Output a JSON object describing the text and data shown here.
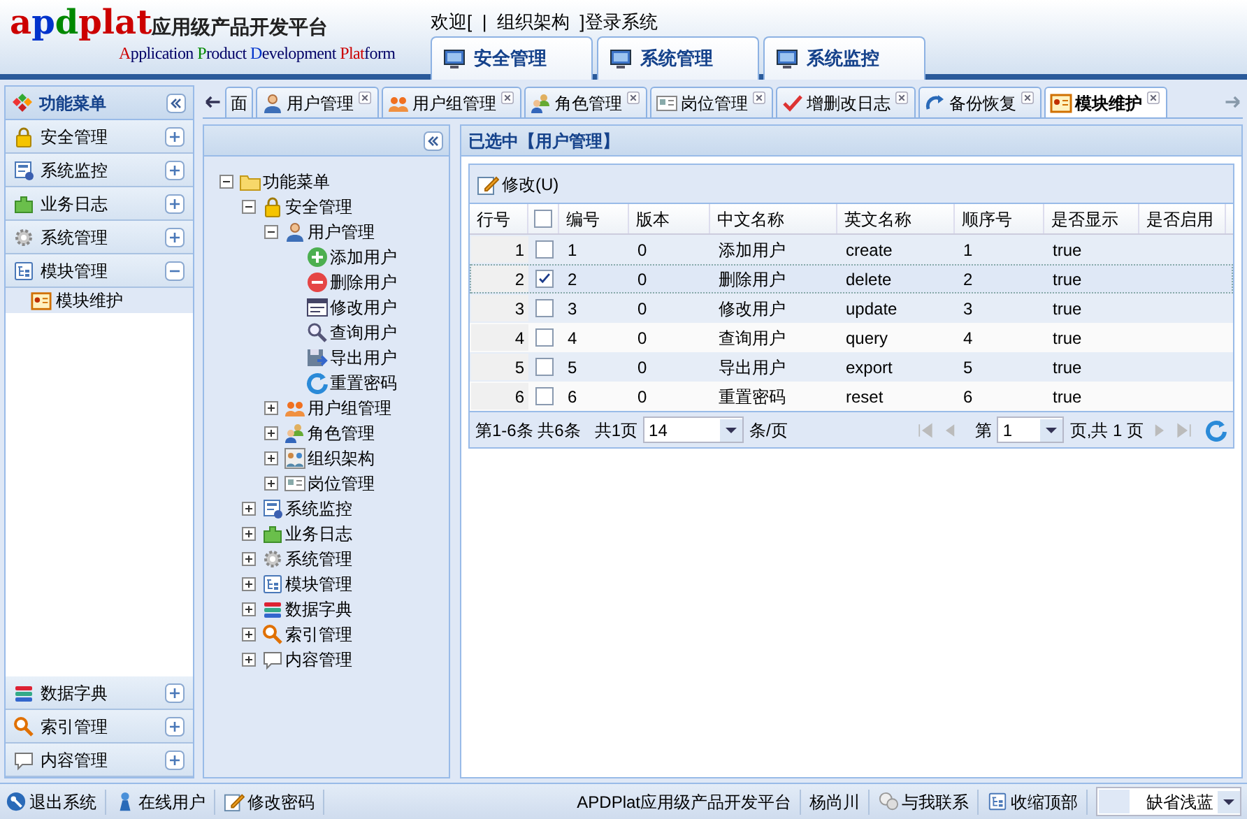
{
  "logo": {
    "brand": [
      {
        "text": "a",
        "color": "#cc0000"
      },
      {
        "text": "p",
        "color": "#0033cc"
      },
      {
        "text": "d",
        "color": "#008800"
      },
      {
        "text": "plat",
        "color": "#cc0000"
      }
    ],
    "subtitle": "应用级产品开发平台",
    "tagline": [
      {
        "text": "A",
        "color": "#cc0000"
      },
      {
        "text": "pplication ",
        "color": "#000066"
      },
      {
        "text": "P",
        "color": "#008800"
      },
      {
        "text": "roduct ",
        "color": "#000066"
      },
      {
        "text": "D",
        "color": "#0033cc"
      },
      {
        "text": "evelopment ",
        "color": "#000066"
      },
      {
        "text": "Plat",
        "color": "#cc0000"
      },
      {
        "text": "form",
        "color": "#000066"
      }
    ]
  },
  "welcome": "欢迎[  |  组织架构  ]登录系统",
  "top_tabs": [
    {
      "label": "安全管理"
    },
    {
      "label": "系统管理"
    },
    {
      "label": "系统监控"
    }
  ],
  "sidebar": {
    "title": "功能菜单",
    "groups": [
      {
        "label": "安全管理",
        "expanded": false
      },
      {
        "label": "系统监控",
        "expanded": false
      },
      {
        "label": "业务日志",
        "expanded": false
      },
      {
        "label": "系统管理",
        "expanded": false
      },
      {
        "label": "模块管理",
        "expanded": true,
        "children": [
          {
            "label": "模块维护",
            "selected": true
          }
        ]
      },
      {
        "label": "数据字典",
        "expanded": false
      },
      {
        "label": "索引管理",
        "expanded": false
      },
      {
        "label": "内容管理",
        "expanded": false
      }
    ]
  },
  "tabs": [
    {
      "label": "面",
      "selected": false,
      "closable": false
    },
    {
      "label": "用户管理",
      "selected": false,
      "closable": true
    },
    {
      "label": "用户组管理",
      "selected": false,
      "closable": true
    },
    {
      "label": "角色管理",
      "selected": false,
      "closable": true
    },
    {
      "label": "岗位管理",
      "selected": false,
      "closable": true
    },
    {
      "label": "增删改日志",
      "selected": false,
      "closable": true
    },
    {
      "label": "备份恢复",
      "selected": false,
      "closable": true
    },
    {
      "label": "模块维护",
      "selected": true,
      "closable": true
    }
  ],
  "tree": [
    {
      "label": "功能菜单",
      "expanded": true,
      "children": [
        {
          "label": "安全管理",
          "expanded": true,
          "children": [
            {
              "label": "用户管理",
              "expanded": true,
              "children": [
                {
                  "label": "添加用户"
                },
                {
                  "label": "删除用户"
                },
                {
                  "label": "修改用户"
                },
                {
                  "label": "查询用户"
                },
                {
                  "label": "导出用户"
                },
                {
                  "label": "重置密码"
                }
              ]
            },
            {
              "label": "用户组管理",
              "expanded": false
            },
            {
              "label": "角色管理",
              "expanded": false
            },
            {
              "label": "组织架构",
              "expanded": false
            },
            {
              "label": "岗位管理",
              "expanded": false
            }
          ]
        },
        {
          "label": "系统监控",
          "expanded": false
        },
        {
          "label": "业务日志",
          "expanded": false
        },
        {
          "label": "系统管理",
          "expanded": false
        },
        {
          "label": "模块管理",
          "expanded": false
        },
        {
          "label": "数据字典",
          "expanded": false
        },
        {
          "label": "索引管理",
          "expanded": false
        },
        {
          "label": "内容管理",
          "expanded": false
        }
      ]
    }
  ],
  "panel": {
    "title": "已选中【用户管理】",
    "toolbar": [
      "修改(U)"
    ],
    "table": {
      "all_checked": false,
      "columns": [
        "行号",
        "",
        "编号",
        "版本",
        "中文名称",
        "英文名称",
        "顺序号",
        "是否显示",
        "是否启用"
      ],
      "rows": [
        {
          "checked": false,
          "selected": false,
          "cells": [
            "1",
            "",
            "1",
            "0",
            "添加用户",
            "create",
            "1",
            "true",
            ""
          ]
        },
        {
          "checked": true,
          "selected": true,
          "cells": [
            "2",
            "",
            "2",
            "0",
            "删除用户",
            "delete",
            "2",
            "true",
            ""
          ]
        },
        {
          "checked": false,
          "selected": false,
          "cells": [
            "3",
            "",
            "3",
            "0",
            "修改用户",
            "update",
            "3",
            "true",
            ""
          ]
        },
        {
          "checked": false,
          "selected": false,
          "cells": [
            "4",
            "",
            "4",
            "0",
            "查询用户",
            "query",
            "4",
            "true",
            ""
          ]
        },
        {
          "checked": false,
          "selected": false,
          "cells": [
            "5",
            "",
            "5",
            "0",
            "导出用户",
            "export",
            "5",
            "true",
            ""
          ]
        },
        {
          "checked": false,
          "selected": false,
          "cells": [
            "6",
            "",
            "6",
            "0",
            "重置密码",
            "reset",
            "6",
            "true",
            ""
          ]
        }
      ]
    },
    "pager": {
      "summary": "第1-6条 共6条",
      "pages": "共1页",
      "page_size": "14",
      "per_page": "条/页",
      "page_label": "第",
      "page": "1",
      "of_pages": "页,共 1 页"
    }
  },
  "status_bar": {
    "left": [
      "退出系统",
      "在线用户",
      "修改密码"
    ],
    "right": [
      "APDPlat应用级产品开发平台",
      "杨尚川",
      "与我联系",
      "收缩顶部"
    ],
    "theme": "缺省浅蓝"
  }
}
